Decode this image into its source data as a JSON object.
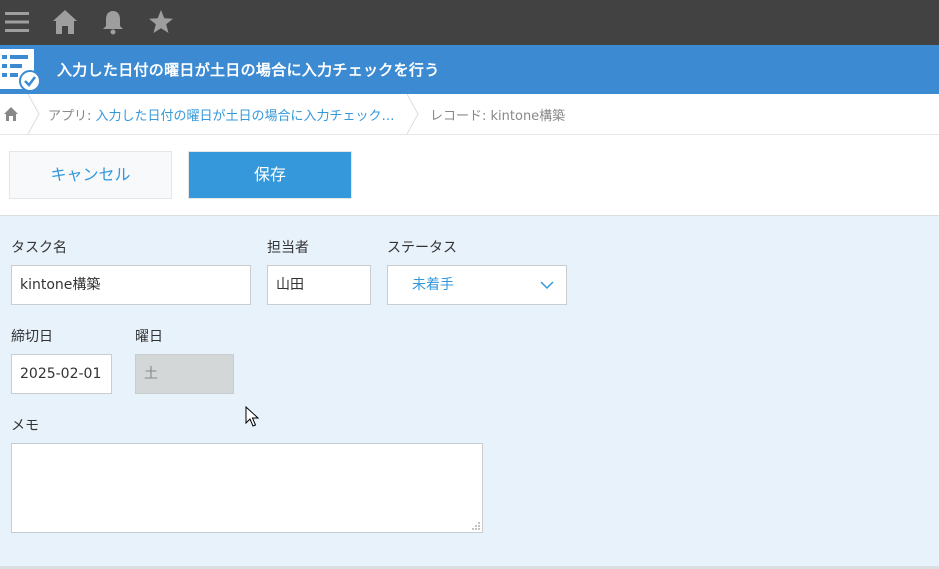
{
  "topbar": {
    "icons": [
      "menu-icon",
      "home-icon",
      "bell-icon",
      "star-icon"
    ]
  },
  "app": {
    "title": "入力した日付の曜日が土日の場合に入力チェックを行う"
  },
  "breadcrumb": {
    "app_prefix": "アプリ: ",
    "app_link": "入力した日付の曜日が土日の場合に入力チェック…",
    "record": "レコード: kintone構築"
  },
  "toolbar": {
    "cancel_label": "キャンセル",
    "save_label": "保存"
  },
  "form": {
    "task_name": {
      "label": "タスク名",
      "value": "kintone構築"
    },
    "assignee": {
      "label": "担当者",
      "value": "山田"
    },
    "status": {
      "label": "ステータス",
      "value": "未着手"
    },
    "deadline": {
      "label": "締切日",
      "value": "2025-02-01"
    },
    "weekday": {
      "label": "曜日",
      "value": "土"
    },
    "memo": {
      "label": "メモ",
      "value": ""
    }
  },
  "colors": {
    "topbar": "#424242",
    "accent": "#3498db",
    "title_bar": "#3c8bd2",
    "form_bg": "#e8f2fb"
  }
}
